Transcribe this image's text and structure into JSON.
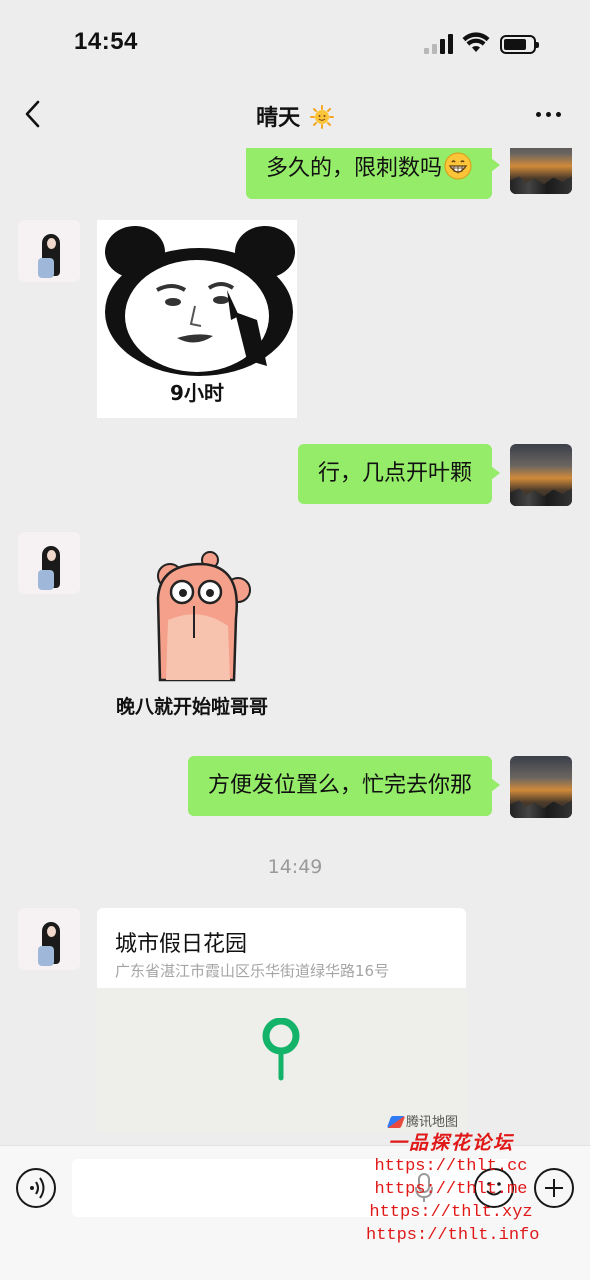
{
  "status_bar": {
    "time": "14:54"
  },
  "nav": {
    "title": "晴天"
  },
  "messages": [
    {
      "from": "self",
      "text": "多久的，限刺数吗"
    },
    {
      "from": "other",
      "type": "sticker",
      "caption": "9小时"
    },
    {
      "from": "self",
      "text": "行，几点开叶颗"
    },
    {
      "from": "other",
      "type": "sticker",
      "caption": "晚八就开始啦哥哥"
    },
    {
      "from": "self",
      "text": "方便发位置么，忙完去你那"
    }
  ],
  "time_separator": "14:49",
  "location": {
    "name": "城市假日花园",
    "address": "广东省湛江市霞山区乐华街道绿华路16号",
    "map_provider": "腾讯地图"
  },
  "watermark": {
    "title": "一品探花论坛",
    "lines": [
      "https://thlt.cc",
      "https://thlt.me",
      "https://thlt.xyz",
      "https://thlt.info"
    ]
  },
  "colors": {
    "bubble_self": "#95ec69",
    "background": "#ededed",
    "pin": "#14b36a",
    "watermark": "#e01818"
  }
}
